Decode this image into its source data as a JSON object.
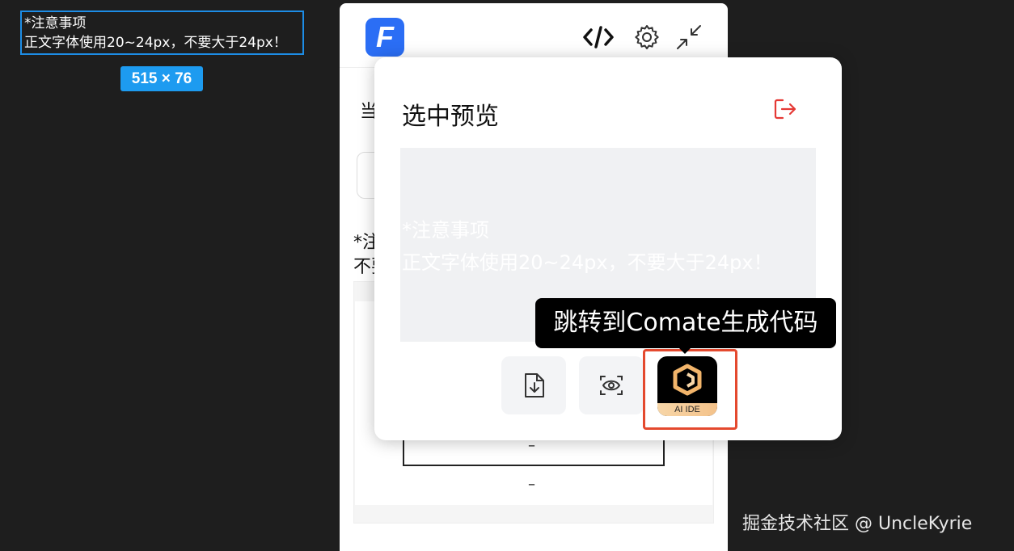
{
  "canvas": {
    "selection_text_line1": "*注意事项",
    "selection_text_line2": "正文字体使用20~24px，不要大于24px！",
    "size_badge": "515 × 76"
  },
  "panel": {
    "logo_letter": "F",
    "icons": [
      "code-icon",
      "gear-icon",
      "collapse-icon"
    ],
    "bg_text_1": "当",
    "bg_text_2": "*注",
    "bg_text_3": "不要",
    "dash_1": "–",
    "dash_2": "–"
  },
  "modal": {
    "title": "选中预览",
    "preview_line1": "*注意事项",
    "preview_line2": "正文字体使用20~24px，不要大于24px！",
    "actions": [
      "download-icon",
      "preview-eye-icon"
    ],
    "comate_label": "AI IDE"
  },
  "tooltip": {
    "text": "跳转到Comate生成代码"
  },
  "watermark": "掘金技术社区 @ UncleKyrie",
  "colors": {
    "accent_blue": "#1d8de6",
    "logo_blue": "#2b6ef5",
    "highlight_red": "#e4492e",
    "exit_red": "#e53935"
  }
}
